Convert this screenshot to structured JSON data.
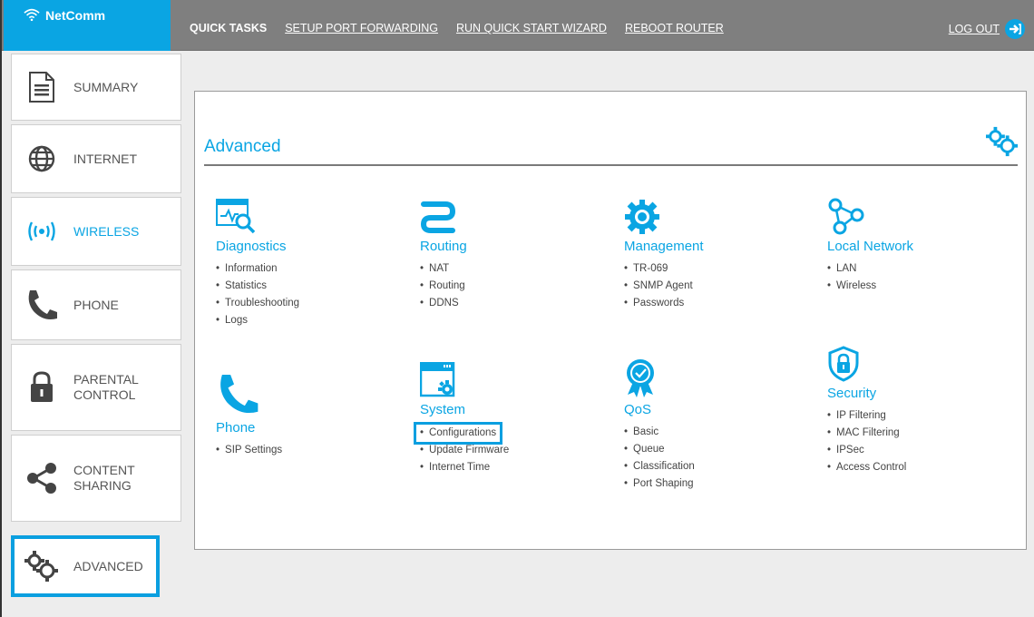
{
  "brand": {
    "name": "NetComm",
    "color": "#0aa5e3"
  },
  "topbar": {
    "quick_tasks": "QUICK TASKS",
    "links": [
      "SETUP PORT FORWARDING",
      "RUN QUICK START WIZARD",
      "REBOOT ROUTER"
    ],
    "logout": "LOG OUT"
  },
  "sidebar": {
    "items": [
      {
        "label": "SUMMARY",
        "icon": "document-icon"
      },
      {
        "label": "INTERNET",
        "icon": "globe-icon"
      },
      {
        "label": "WIRELESS",
        "icon": "wireless-icon",
        "active": true
      },
      {
        "label": "PHONE",
        "icon": "phone-icon"
      },
      {
        "label": "PARENTAL\nCONTROL",
        "icon": "lock-icon"
      },
      {
        "label": "CONTENT\nSHARING",
        "icon": "share-icon"
      },
      {
        "label": "ADVANCED",
        "icon": "gears-icon",
        "highlighted": true
      }
    ]
  },
  "main": {
    "title": "Advanced",
    "groups": [
      {
        "title": "Diagnostics",
        "icon": "diagnostics-icon",
        "items": [
          "Information",
          "Statistics",
          "Troubleshooting",
          "Logs"
        ]
      },
      {
        "title": "Routing",
        "icon": "routing-icon",
        "items": [
          "NAT",
          "Routing",
          "DDNS"
        ]
      },
      {
        "title": "Management",
        "icon": "management-icon",
        "items": [
          "TR-069",
          "SNMP Agent",
          "Passwords"
        ]
      },
      {
        "title": "Local Network",
        "icon": "local-network-icon",
        "items": [
          "LAN",
          "Wireless"
        ]
      },
      {
        "title": "Phone",
        "icon": "phone-icon",
        "items": [
          "SIP Settings"
        ]
      },
      {
        "title": "System",
        "icon": "system-icon",
        "items": [
          "Configurations",
          "Update Firmware",
          "Internet Time"
        ],
        "highlighted_item": "Configurations"
      },
      {
        "title": "QoS",
        "icon": "qos-icon",
        "items": [
          "Basic",
          "Queue",
          "Classification",
          "Port Shaping"
        ]
      },
      {
        "title": "Security",
        "icon": "security-icon",
        "items": [
          "IP Filtering",
          "MAC Filtering",
          "IPSec",
          "Access Control"
        ]
      }
    ]
  }
}
